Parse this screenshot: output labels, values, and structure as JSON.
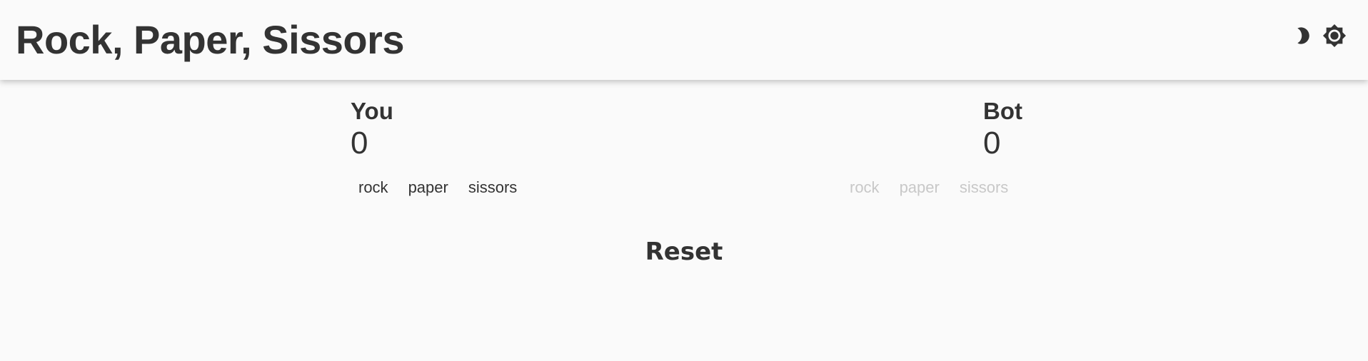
{
  "app": {
    "title": "Rock, Paper, Sissors"
  },
  "header": {
    "icons": [
      "moon-icon",
      "sun-icon"
    ]
  },
  "players": {
    "you": {
      "name": "You",
      "score": "0",
      "choices": [
        "rock",
        "paper",
        "sissors"
      ]
    },
    "bot": {
      "name": "Bot",
      "score": "0",
      "choices": [
        "rock",
        "paper",
        "sissors"
      ]
    }
  },
  "actions": {
    "reset_label": "Reset"
  },
  "colors": {
    "background": "#fafafa",
    "text": "#333333",
    "disabled_text": "#c8c8c8"
  }
}
